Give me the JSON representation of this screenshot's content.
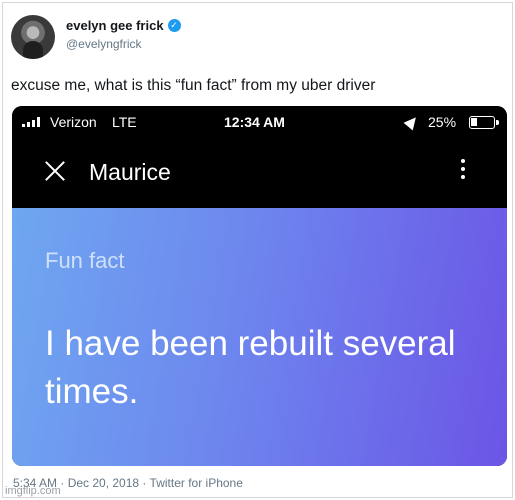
{
  "author": {
    "display_name": "evelyn gee frick",
    "handle": "@evelyngfrick",
    "verified_icon": "verified-badge-icon",
    "accent": "#1d9bf0"
  },
  "tweet": {
    "text": "excuse me, what is this “fun fact” from my uber driver",
    "meta": "5:34 AM · Dec 20, 2018 · Twitter for iPhone"
  },
  "screenshot": {
    "status_bar": {
      "carrier": "Verizon",
      "network": "LTE",
      "time": "12:34 AM",
      "battery": "25%"
    },
    "app_bar": {
      "contact_name": "Maurice"
    },
    "card": {
      "label": "Fun fact",
      "body": "I have been rebuilt several times.",
      "gradient_start": "#6fa7f0",
      "gradient_end": "#6c55e6"
    }
  },
  "watermark": "imgflip.com"
}
